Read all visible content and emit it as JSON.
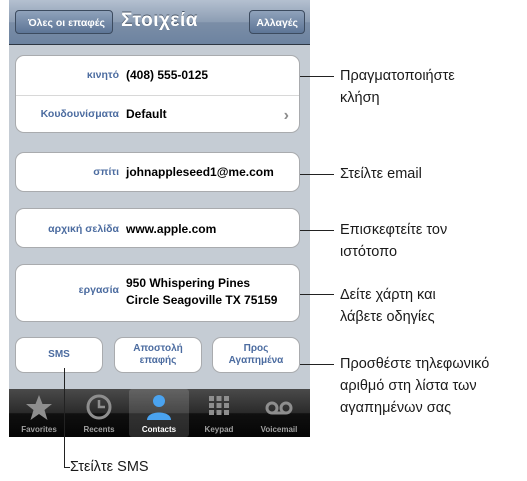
{
  "navbar": {
    "back_label": "Όλες οι επαφές",
    "title": "Στοιχεία",
    "edit_label": "Αλλαγές"
  },
  "contact": {
    "mobile_label": "κινητό",
    "mobile_value": "(408) 555-0125",
    "ringtone_label": "Κουδουνίσματα",
    "ringtone_value": "Default",
    "home_label": "σπίτι",
    "home_value": "johnappleseed1@me.com",
    "homepage_label": "αρχική σελίδα",
    "homepage_value": "www.apple.com",
    "work_label": "εργασία",
    "work_line1": "950 Whispering Pines",
    "work_line2": "Circle Seagoville TX 75159"
  },
  "actions": {
    "sms": "SMS",
    "send_contact_1": "Αποστολή",
    "send_contact_2": "επαφής",
    "favorites_1": "Προς",
    "favorites_2": "Αγαπημένα"
  },
  "tabbar": [
    "Favorites",
    "Recents",
    "Contacts",
    "Keypad",
    "Voicemail"
  ],
  "callouts": {
    "call_1": "Πραγματοποιήστε",
    "call_2": "κλήση",
    "email": "Στείλτε email",
    "web_1": "Επισκεφτείτε τον",
    "web_2": "ιστότοπο",
    "map_1": "Δείτε χάρτη και",
    "map_2": "λάβετε οδηγίες",
    "fav_1": "Προσθέστε τηλεφωνικό",
    "fav_2": "αριθμό στη λίστα των",
    "fav_3": "αγαπημένων σας",
    "sms": "Στείλτε SMS"
  },
  "colors": {
    "label_blue": "#4c6ca0",
    "nav_blue": "#6d83a0",
    "background": "#c5ccd4",
    "active_tab": "#4aa3f0"
  }
}
